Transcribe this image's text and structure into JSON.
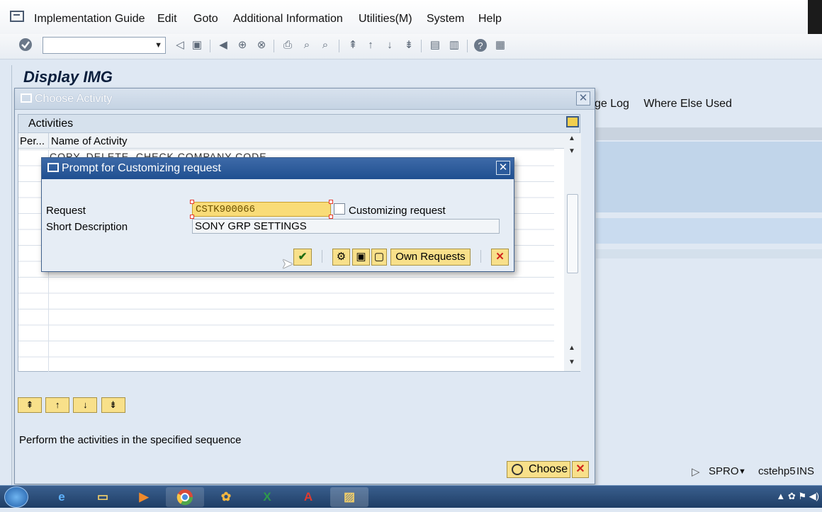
{
  "menu": {
    "items": [
      "Implementation Guide",
      "Edit",
      "Goto",
      "Additional Information",
      "Utilities(M)",
      "System",
      "Help"
    ]
  },
  "toolbar": {
    "command_value": "",
    "icons": [
      "enter-icon",
      "back-icon",
      "save-icon",
      "back-nav-icon",
      "exit-icon",
      "cancel-icon",
      "print-icon",
      "find-icon",
      "find-next-icon",
      "first-page-icon",
      "prev-page-icon",
      "next-page-icon",
      "last-page-icon",
      "new-session-icon",
      "shortcut-icon",
      "help-icon",
      "layout-icon"
    ]
  },
  "main": {
    "title": "Display IMG",
    "links": [
      "ge Log",
      "Where Else Used"
    ]
  },
  "choose_activity": {
    "title": "Choose Activity",
    "section_title": "Activities",
    "col_per": "Per...",
    "col_name": "Name of Activity",
    "row_text": "COPY, DELETE, CHECK COMPANY CODE",
    "hint": "Perform the activities in the specified sequence",
    "choose_label": "Choose"
  },
  "prompt": {
    "title": "Prompt for Customizing request",
    "request_label": "Request",
    "request_value": "CSTK900066",
    "request_type": "Customizing request",
    "short_desc_label": "Short Description",
    "short_desc_value": "SONY GRP SETTINGS",
    "own_requests_label": "Own Requests"
  },
  "status": {
    "transaction": "SPRO",
    "server": "cstehp5",
    "mode": "INS"
  },
  "colors": {
    "prompt_title": "#1f4f90",
    "button_yellow": "#f8e08a",
    "field_highlight": "#f9dc78"
  }
}
